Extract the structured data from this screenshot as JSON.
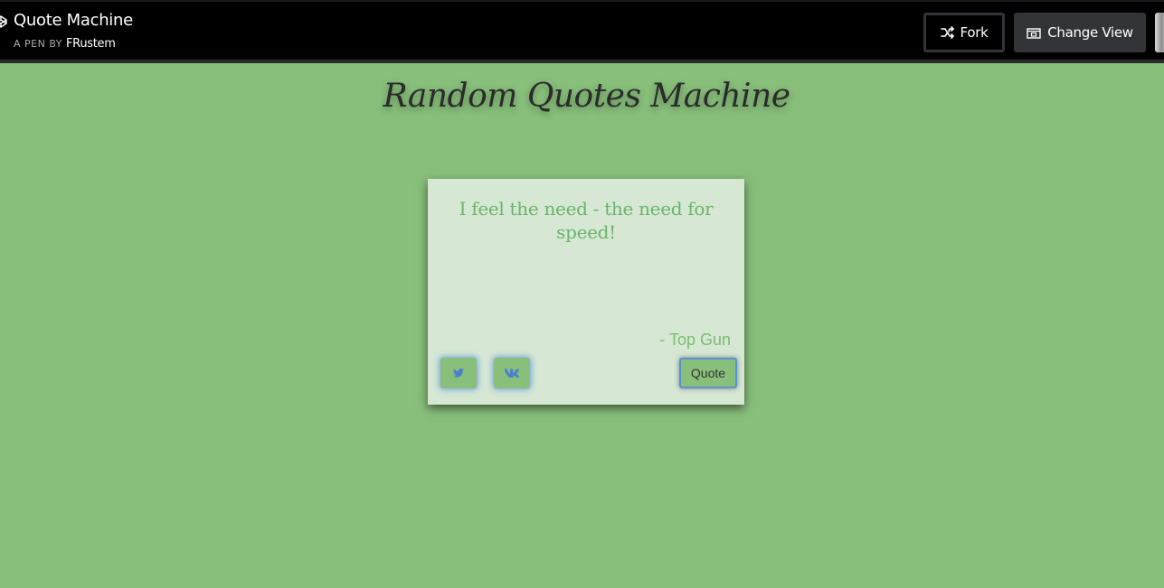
{
  "header": {
    "pen_title": "Quote Machine",
    "pen_by_label": "A PEN BY",
    "author": "FRustem",
    "fork_label": "Fork",
    "change_view_label": "Change View"
  },
  "main": {
    "heading": "Random Quotes Machine",
    "quote": {
      "text": "I feel the need - the need for speed!",
      "author": "- Top Gun"
    },
    "buttons": {
      "quote_label": "Quote",
      "share_twitter_icon": "twitter-icon",
      "share_vk_icon": "vk-icon"
    }
  },
  "colors": {
    "header_bg": "#000000",
    "page_bg": "#88bf7b",
    "card_bg": "#d6e8d4",
    "quote_text": "#6ab46a",
    "icon_blue": "#4a7fd0"
  }
}
